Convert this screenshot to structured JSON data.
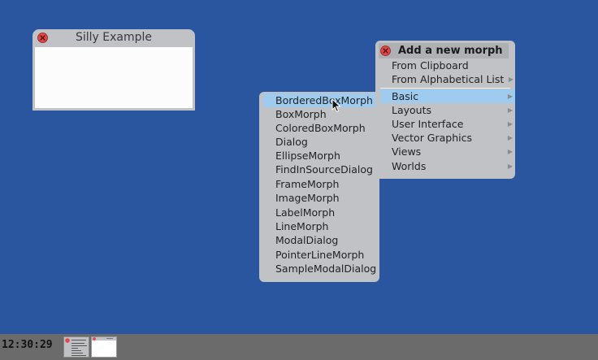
{
  "window": {
    "title": "Silly Example"
  },
  "main_menu": {
    "title": "Add a new morph",
    "items": [
      {
        "label": "From Clipboard",
        "submenu": false
      },
      {
        "label": "From Alphabetical List",
        "submenu": true
      },
      {
        "label": "Basic",
        "submenu": true,
        "selected": true
      },
      {
        "label": "Layouts",
        "submenu": true
      },
      {
        "label": "User Interface",
        "submenu": true
      },
      {
        "label": "Vector Graphics",
        "submenu": true
      },
      {
        "label": "Views",
        "submenu": true
      },
      {
        "label": "Worlds",
        "submenu": true
      }
    ]
  },
  "sub_menu": {
    "items": [
      {
        "label": "BorderedBoxMorph",
        "selected": true
      },
      {
        "label": "BoxMorph"
      },
      {
        "label": "ColoredBoxMorph"
      },
      {
        "label": "Dialog"
      },
      {
        "label": "EllipseMorph"
      },
      {
        "label": "FindInSourceDialog"
      },
      {
        "label": "FrameMorph"
      },
      {
        "label": "ImageMorph"
      },
      {
        "label": "LabelMorph"
      },
      {
        "label": "LineMorph"
      },
      {
        "label": "ModalDialog"
      },
      {
        "label": "PointerLineMorph"
      },
      {
        "label": "SampleModalDialog"
      }
    ]
  },
  "taskbar": {
    "clock": "12:30:29"
  },
  "icons": {
    "close": "close-icon",
    "submenu_arrow": "▶"
  },
  "colors": {
    "desktop": "#2a56a0",
    "menu_bg": "#c0c2c6",
    "selection": "#9fcbef",
    "close_red": "#e04848",
    "taskbar": "#6b6b6b"
  }
}
